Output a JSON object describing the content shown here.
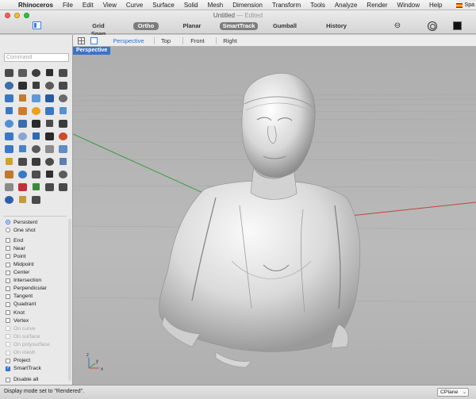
{
  "menubar": {
    "app": "Rhinoceros",
    "items": [
      "File",
      "Edit",
      "View",
      "Curve",
      "Surface",
      "Solid",
      "Mesh",
      "Dimension",
      "Transform",
      "Tools",
      "Analyze",
      "Render",
      "Window",
      "Help"
    ],
    "input_source": "Spa"
  },
  "window": {
    "title": "Untitled",
    "edited": "— Edited"
  },
  "toolbar": {
    "buttons": [
      {
        "label": "Grid Snap",
        "on": false
      },
      {
        "label": "Ortho",
        "on": true
      },
      {
        "label": "Planar",
        "on": false
      },
      {
        "label": "SmartTrack",
        "on": true
      },
      {
        "label": "Gumball",
        "on": false
      },
      {
        "label": "History",
        "on": false
      }
    ]
  },
  "command": {
    "placeholder": "Command",
    "value": ""
  },
  "tools": {
    "colors": [
      "#4a4a4a",
      "#5a5a5a",
      "#3d3d3d",
      "#2f2f2f",
      "#4c4c4c",
      "#3b6ea8",
      "#2f2f2f",
      "#3d3d3d",
      "#5a5a5a",
      "#4a4a4a",
      "#3a78c6",
      "#c67a2e",
      "#5e9ad8",
      "#2a5aa0",
      "#6a6a6a",
      "#3a78c6",
      "#d07a2a",
      "#e8a21c",
      "#3a78c6",
      "#5890d0",
      "#4f8fd4",
      "#3a6cb0",
      "#2a2a2a",
      "#4a4a4a",
      "#3b3b3b",
      "#3a78c6",
      "#8aa6cf",
      "#2f6ab8",
      "#2a2a2a",
      "#d04a2a",
      "#3a78c6",
      "#4a82c8",
      "#5a5a5a",
      "#8c8c8c",
      "#5e8ec6",
      "#d0a030",
      "#4a4a4a",
      "#3a3a3a",
      "#4b4b4b",
      "#5b7fb0",
      "#c07830",
      "#3a78c6",
      "#4d4d4d",
      "#2f2f2f",
      "#5b5b5b",
      "#8a8a8a",
      "#c0303a",
      "#3a8a3a",
      "#4a4a4a",
      "#4a4a4a",
      "#2f5fa8",
      "#c59a3a",
      "#4a4a4a",
      "",
      ""
    ]
  },
  "osnaps": {
    "persistent": "Persistent",
    "one_shot": "One shot",
    "items": [
      {
        "label": "End",
        "checked": false,
        "dim": false
      },
      {
        "label": "Near",
        "checked": false,
        "dim": false
      },
      {
        "label": "Point",
        "checked": false,
        "dim": false
      },
      {
        "label": "Midpoint",
        "checked": false,
        "dim": false
      },
      {
        "label": "Center",
        "checked": false,
        "dim": false
      },
      {
        "label": "Intersection",
        "checked": false,
        "dim": false
      },
      {
        "label": "Perpendicular",
        "checked": false,
        "dim": false
      },
      {
        "label": "Tangent",
        "checked": false,
        "dim": false
      },
      {
        "label": "Quadrant",
        "checked": false,
        "dim": false
      },
      {
        "label": "Knot",
        "checked": false,
        "dim": false
      },
      {
        "label": "Vertex",
        "checked": false,
        "dim": false
      },
      {
        "label": "On curve",
        "checked": false,
        "dim": true
      },
      {
        "label": "On surface",
        "checked": false,
        "dim": true
      },
      {
        "label": "On polysurface",
        "checked": false,
        "dim": true
      },
      {
        "label": "On mesh",
        "checked": false,
        "dim": true
      },
      {
        "label": "Project",
        "checked": false,
        "dim": false
      },
      {
        "label": "SmartTrack",
        "checked": true,
        "dim": false
      },
      {
        "label": "Disable all",
        "checked": false,
        "dim": false
      }
    ]
  },
  "viewport_tabs": {
    "tabs": [
      "Perspective",
      "Top",
      "Front",
      "Right"
    ],
    "active": "Perspective"
  },
  "viewport": {
    "label": "Perspective",
    "axis_colors": {
      "x": "#c0463e",
      "y": "#3a9a3a",
      "z": "#3a6ac8"
    },
    "axis_labels": {
      "z": "z",
      "x": "x",
      "y": "y"
    }
  },
  "statusbar": {
    "message": "Display mode set to \"Rendered\".",
    "cplane": "CPlane"
  }
}
